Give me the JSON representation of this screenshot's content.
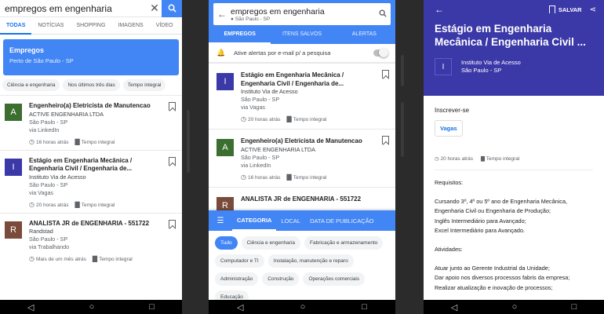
{
  "phone1": {
    "search_query": "empregos em engenharia",
    "clear_icon": "close-icon",
    "tabs": [
      "TODAS",
      "NOTÍCIAS",
      "SHOPPING",
      "IMAGENS",
      "VÍDEO"
    ],
    "card_title": "Empregos",
    "card_subtitle": "Perto de São Paulo - SP",
    "chips": [
      "Ciência e engenharia",
      "Nos últimos três dias",
      "Tempo integral"
    ],
    "jobs": [
      {
        "logo": "A",
        "logo_color": "#3c6e2f",
        "title": "Engenheiro(a) Eletricista de Manutencao",
        "company": "ACTIVE ENGENHARIA LTDA",
        "location": "São Paulo - SP",
        "via": "via LinkedIn",
        "posted": "16 horas atrás",
        "type": "Tempo integral"
      },
      {
        "logo": "I",
        "logo_color": "#3b38a8",
        "title": "Estágio em Engenharia Mecânica / Engenharia Civil / Engenharia de...",
        "company": "Instituto Via de Acesso",
        "location": "São Paulo - SP",
        "via": "via Vagas",
        "posted": "20 horas atrás",
        "type": "Tempo integral"
      },
      {
        "logo": "R",
        "logo_color": "#7a4a3a",
        "title": "ANALISTA JR de ENGENHARIA - 551722",
        "company": "Randstad",
        "location": "São Paulo - SP",
        "via": "via Trabalhando",
        "posted": "Mais de um mês atrás",
        "type": "Tempo integral"
      }
    ]
  },
  "phone2": {
    "search_query": "empregos em engenharia",
    "search_location": "São Paulo - SP",
    "tabs": [
      "EMPREGOS",
      "ITENS SALVOS",
      "ALERTAS"
    ],
    "alert_text": "Ative alertas por e-mail p/ a pesquisa",
    "jobs": [
      {
        "logo": "I",
        "logo_color": "#3b38a8",
        "title": "Estágio em Engenharia Mecânica / Engenharia Civil / Engenharia de...",
        "company": "Instituto Via de Acesso",
        "location": "São Paulo - SP",
        "via": "via Vagas",
        "posted": "20 horas atrás",
        "type": "Tempo integral"
      },
      {
        "logo": "A",
        "logo_color": "#3c6e2f",
        "title": "Engenheiro(a) Eletricista de Manutencao",
        "company": "ACTIVE ENGENHARIA LTDA",
        "location": "São Paulo - SP",
        "via": "via LinkedIn",
        "posted": "16 horas atrás",
        "type": "Tempo integral"
      },
      {
        "logo": "R",
        "logo_color": "#7a4a3a",
        "title": "ANALISTA JR de ENGENHARIA - 551722",
        "company": "",
        "location": "",
        "via": "",
        "posted": "",
        "type": ""
      }
    ],
    "filter_tabs": [
      "CATEGORIA",
      "LOCAL",
      "DATA DE PUBLICAÇÃO"
    ],
    "filter_chips": [
      "Tudo",
      "Ciência e engenharia",
      "Fabricação e armazenamento",
      "Computador e TI",
      "Instalação, manutenção e reparo",
      "Administração",
      "Construção",
      "Operações comerciais",
      "Educação"
    ]
  },
  "phone3": {
    "salvar": "SALVAR",
    "title": "Estágio em Engenharia Mecânica / Engenharia Civil ...",
    "company_logo": "I",
    "company": "Instituto Via de Acesso",
    "location": "São Paulo - SP",
    "inscrever": "Inscrever-se",
    "vagas_button": "Vagas",
    "posted": "20 horas atrás",
    "type": "Tempo integral",
    "requisitos_label": "Requisitos:",
    "requisitos": [
      "Cursando 3º, 4º ou 5º ano de Engenharia Mecânica, Engenharia Civil ou Engenharia de Produção;",
      "Inglês Intermediário para Avançado;",
      "Excel Intermediário para Avançado."
    ],
    "atividades_label": "Atividades:",
    "atividades": [
      "Atuar junto ao Gerente Industrial da Unidade;",
      "Dar apoio nos diversos processos fabris da empresa;",
      "Realizar atualização e inovação de processos;"
    ]
  }
}
